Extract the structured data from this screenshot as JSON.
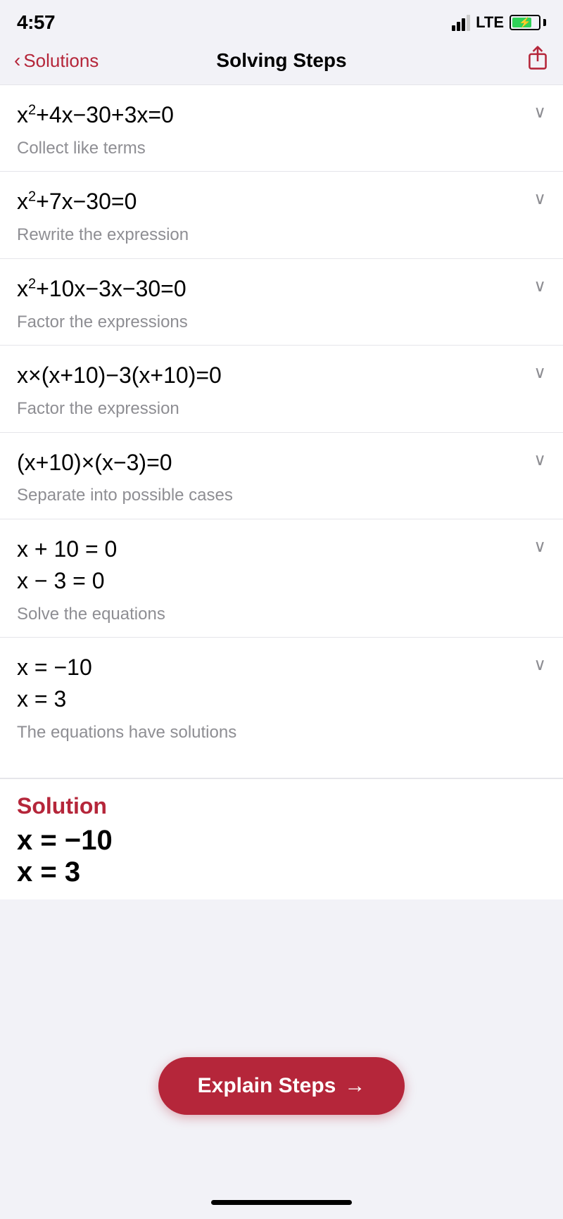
{
  "statusBar": {
    "time": "4:57",
    "lte": "LTE"
  },
  "navBar": {
    "backLabel": "Solutions",
    "title": "Solving Steps"
  },
  "steps": [
    {
      "equation": "x² + 4x − 30 + 3x = 0",
      "equationHtml": "x<sup>2</sup>+4x−30+3x=0",
      "description": "Collect like terms"
    },
    {
      "equation": "x² + 7x − 30 = 0",
      "equationHtml": "x<sup>2</sup>+7x−30=0",
      "description": "Rewrite the expression"
    },
    {
      "equation": "x² + 10x − 3x − 30 = 0",
      "equationHtml": "x<sup>2</sup>+10x−3x−30=0",
      "description": "Factor the expressions"
    },
    {
      "equation": "x × (x + 10) − 3(x + 10) = 0",
      "equationHtml": "x×(x+10)−3(x+10)=0",
      "description": "Factor the expression"
    },
    {
      "equation": "(x + 10) × (x − 3) = 0",
      "equationHtml": "(x+10)×(x−3)=0",
      "description": "Separate into possible cases"
    },
    {
      "equationLine1": "x + 10 = 0",
      "equationLine2": "x − 3 = 0",
      "description": "Solve the equations",
      "multiLine": true
    },
    {
      "equationLine1": "x = −10",
      "equationLine2": "x = 3",
      "description": "The equations have solutions",
      "multiLine": true,
      "last": true
    }
  ],
  "explainBtn": {
    "label": "Explain Steps",
    "arrow": "→"
  },
  "solution": {
    "label": "Solution",
    "line1": "x = −10",
    "line2": "x = 3"
  }
}
